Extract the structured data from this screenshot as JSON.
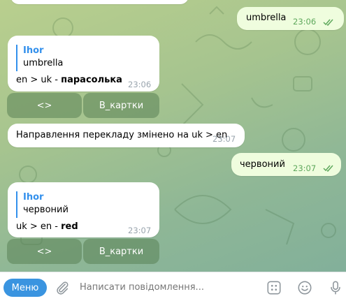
{
  "messages": [
    {
      "type": "out",
      "text": "umbrella",
      "time": "23:06"
    },
    {
      "type": "in",
      "reply_name": "Ihor",
      "reply_text": "umbrella",
      "body_plain": "en > uk - ",
      "body_bold": "парасолька",
      "time": "23:06"
    },
    {
      "type": "in",
      "text": "Направлення перекладу змінено на uk > en",
      "time": "23:07"
    },
    {
      "type": "out",
      "text": "червоний",
      "time": "23:07"
    },
    {
      "type": "in",
      "reply_name": "Ihor",
      "reply_text": "червоний",
      "body_plain": "uk > en - ",
      "body_bold": "red",
      "time": "23:07"
    }
  ],
  "keyboard1": {
    "swap": "<>",
    "cards": "В_картки"
  },
  "keyboard2": {
    "swap": "<>",
    "cards": "В_картки"
  },
  "composer": {
    "menu_label": "Меню",
    "placeholder": "Написати повідомлення...",
    "icons": [
      "paperclip-icon",
      "keypad-icon",
      "emoji-icon",
      "microphone-icon"
    ]
  },
  "colors": {
    "accent": "#3390ec",
    "outgoing": "#effdde",
    "check": "#5ea85c"
  }
}
